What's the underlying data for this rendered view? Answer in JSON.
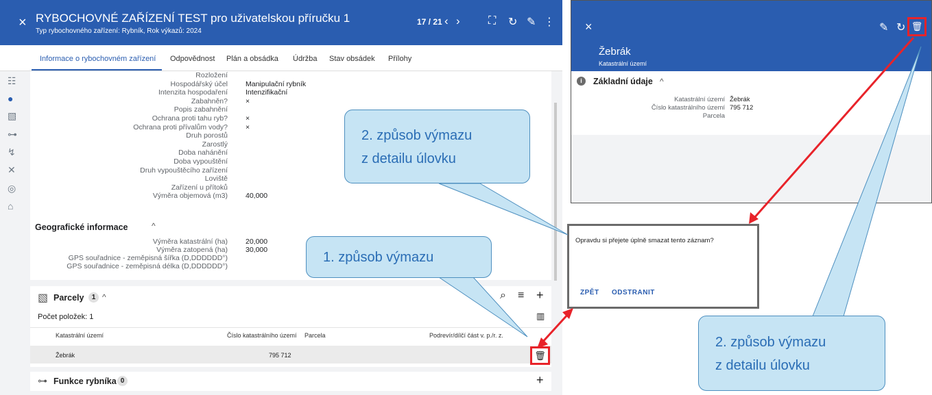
{
  "left_header": {
    "close": "×",
    "title": "RYBOCHOVNÉ ZAŘÍZENÍ TEST pro uživatelskou příručku 1",
    "subtitle": "Typ rybochovného zařízení: Rybník, Rok výkazů: 2024",
    "pager": "17 / 21",
    "prev": "‹",
    "next": "›",
    "fullscreen_icon": "⛶",
    "refresh_icon": "↻",
    "edit_icon": "✎",
    "more_icon": "⋮"
  },
  "tabs": [
    "Informace o rybochovném zařízení",
    "Odpovědnost",
    "Plán a obsádka",
    "Údržba",
    "Stav obsádek",
    "Přílohy"
  ],
  "sidebar_icons": [
    "list-tree-icon",
    "info-icon",
    "map-icon",
    "hierarchy-icon",
    "fish-icon",
    "tools-icon",
    "badge-icon",
    "bucket-icon"
  ],
  "sidebar_glyphs": [
    "☷",
    "●",
    "▧",
    "⊶",
    "↯",
    "✕",
    "◎",
    "⌂"
  ],
  "fields": [
    {
      "label": "Rozložení",
      "value": ""
    },
    {
      "label": "Hospodářský účel",
      "value": "Manipulační rybník"
    },
    {
      "label": "Intenzita hospodaření",
      "value": "Intenzifikační"
    },
    {
      "label": "Zabahněn?",
      "value": "×"
    },
    {
      "label": "Popis zabahnění",
      "value": ""
    },
    {
      "label": "Ochrana proti tahu ryb?",
      "value": "×"
    },
    {
      "label": "Ochrana proti přívalům vody?",
      "value": "×"
    },
    {
      "label": "Druh porostů",
      "value": ""
    },
    {
      "label": "Zarostlý",
      "value": ""
    },
    {
      "label": "Doba nahánění",
      "value": ""
    },
    {
      "label": "Doba vypouštění",
      "value": ""
    },
    {
      "label": "Druh vypouštěcího zařízení",
      "value": ""
    },
    {
      "label": "Loviště",
      "value": ""
    },
    {
      "label": "Zařízení u přítoků",
      "value": ""
    },
    {
      "label": "Výměra objemová (m3)",
      "value": "40,000"
    }
  ],
  "geo_section": {
    "title": "Geografické informace",
    "chevron": "^",
    "fields": [
      {
        "label": "Výměra katastrální (ha)",
        "value": "20,000"
      },
      {
        "label": "Výměra zatopená (ha)",
        "value": "30,000"
      },
      {
        "label": "GPS souřadnice - zeměpisná šířka (D,DDDDDD°)",
        "value": ""
      },
      {
        "label": "GPS souřadnice - zeměpisná délka (D,DDDDDD°)",
        "value": ""
      }
    ]
  },
  "parcely": {
    "icon": "▧",
    "title": "Parcely",
    "count": "1",
    "chevron": "^",
    "search_icon": "⌕",
    "list_icon": "≡",
    "add_icon": "+",
    "columns_icon": "▥",
    "items_count": "Počet položek: 1",
    "columns": [
      "Katastrální území",
      "Číslo katastrálního území",
      "Parcela",
      "Podrevír/dílčí část v. p./r. z."
    ],
    "rows": [
      {
        "katastralni_uzemi": "Žebrák",
        "cislo": "795 712",
        "parcela": "",
        "podrevir": ""
      }
    ],
    "delete_icon": "🗑"
  },
  "funkce": {
    "icon": "⊶",
    "title": "Funkce rybníka",
    "count": "0",
    "add_icon": "+"
  },
  "right_app": {
    "close": "×",
    "edit_icon": "✎",
    "refresh_icon": "↻",
    "delete_icon": "🗑",
    "title": "Žebrák",
    "subtitle": "Katastrální území",
    "section_icon": "i",
    "section_title": "Základní údaje",
    "section_chevron": "^",
    "fields": [
      {
        "label": "Katastrální území",
        "value": "Žebrák"
      },
      {
        "label": "Číslo katastrálního území",
        "value": "795 712"
      },
      {
        "label": "Parcela",
        "value": ""
      }
    ]
  },
  "dialog": {
    "message": "Opravdu si přejete úplně smazat tento záznam?",
    "back_label": "ZPĚT",
    "delete_label": "ODSTRANIT"
  },
  "callouts": {
    "c1_line1": "2. způsob výmazu",
    "c1_line2": "z detailu úlovku",
    "c2_line1": "1. způsob výmazu",
    "c3_line1": "2. způsob výmazu",
    "c3_line2": "z detailu úlovku"
  },
  "colors": {
    "header_blue": "#2a5db0",
    "highlight_red": "#e8232a",
    "callout_fill": "#c6e4f4",
    "callout_border": "#4d8fbf",
    "callout_text": "#2a6db5"
  }
}
